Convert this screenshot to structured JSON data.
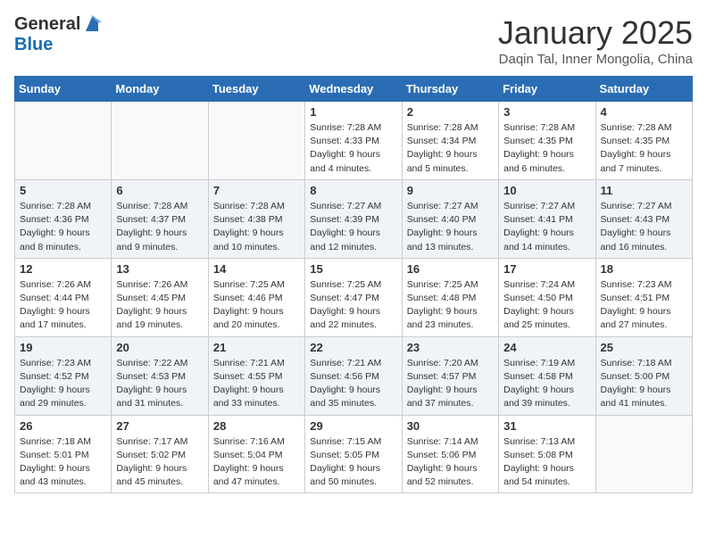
{
  "header": {
    "logo_general": "General",
    "logo_blue": "Blue",
    "title": "January 2025",
    "subtitle": "Daqin Tal, Inner Mongolia, China"
  },
  "weekdays": [
    "Sunday",
    "Monday",
    "Tuesday",
    "Wednesday",
    "Thursday",
    "Friday",
    "Saturday"
  ],
  "weeks": [
    [
      {
        "day": "",
        "info": ""
      },
      {
        "day": "",
        "info": ""
      },
      {
        "day": "",
        "info": ""
      },
      {
        "day": "1",
        "info": "Sunrise: 7:28 AM\nSunset: 4:33 PM\nDaylight: 9 hours and 4 minutes."
      },
      {
        "day": "2",
        "info": "Sunrise: 7:28 AM\nSunset: 4:34 PM\nDaylight: 9 hours and 5 minutes."
      },
      {
        "day": "3",
        "info": "Sunrise: 7:28 AM\nSunset: 4:35 PM\nDaylight: 9 hours and 6 minutes."
      },
      {
        "day": "4",
        "info": "Sunrise: 7:28 AM\nSunset: 4:35 PM\nDaylight: 9 hours and 7 minutes."
      }
    ],
    [
      {
        "day": "5",
        "info": "Sunrise: 7:28 AM\nSunset: 4:36 PM\nDaylight: 9 hours and 8 minutes."
      },
      {
        "day": "6",
        "info": "Sunrise: 7:28 AM\nSunset: 4:37 PM\nDaylight: 9 hours and 9 minutes."
      },
      {
        "day": "7",
        "info": "Sunrise: 7:28 AM\nSunset: 4:38 PM\nDaylight: 9 hours and 10 minutes."
      },
      {
        "day": "8",
        "info": "Sunrise: 7:27 AM\nSunset: 4:39 PM\nDaylight: 9 hours and 12 minutes."
      },
      {
        "day": "9",
        "info": "Sunrise: 7:27 AM\nSunset: 4:40 PM\nDaylight: 9 hours and 13 minutes."
      },
      {
        "day": "10",
        "info": "Sunrise: 7:27 AM\nSunset: 4:41 PM\nDaylight: 9 hours and 14 minutes."
      },
      {
        "day": "11",
        "info": "Sunrise: 7:27 AM\nSunset: 4:43 PM\nDaylight: 9 hours and 16 minutes."
      }
    ],
    [
      {
        "day": "12",
        "info": "Sunrise: 7:26 AM\nSunset: 4:44 PM\nDaylight: 9 hours and 17 minutes."
      },
      {
        "day": "13",
        "info": "Sunrise: 7:26 AM\nSunset: 4:45 PM\nDaylight: 9 hours and 19 minutes."
      },
      {
        "day": "14",
        "info": "Sunrise: 7:25 AM\nSunset: 4:46 PM\nDaylight: 9 hours and 20 minutes."
      },
      {
        "day": "15",
        "info": "Sunrise: 7:25 AM\nSunset: 4:47 PM\nDaylight: 9 hours and 22 minutes."
      },
      {
        "day": "16",
        "info": "Sunrise: 7:25 AM\nSunset: 4:48 PM\nDaylight: 9 hours and 23 minutes."
      },
      {
        "day": "17",
        "info": "Sunrise: 7:24 AM\nSunset: 4:50 PM\nDaylight: 9 hours and 25 minutes."
      },
      {
        "day": "18",
        "info": "Sunrise: 7:23 AM\nSunset: 4:51 PM\nDaylight: 9 hours and 27 minutes."
      }
    ],
    [
      {
        "day": "19",
        "info": "Sunrise: 7:23 AM\nSunset: 4:52 PM\nDaylight: 9 hours and 29 minutes."
      },
      {
        "day": "20",
        "info": "Sunrise: 7:22 AM\nSunset: 4:53 PM\nDaylight: 9 hours and 31 minutes."
      },
      {
        "day": "21",
        "info": "Sunrise: 7:21 AM\nSunset: 4:55 PM\nDaylight: 9 hours and 33 minutes."
      },
      {
        "day": "22",
        "info": "Sunrise: 7:21 AM\nSunset: 4:56 PM\nDaylight: 9 hours and 35 minutes."
      },
      {
        "day": "23",
        "info": "Sunrise: 7:20 AM\nSunset: 4:57 PM\nDaylight: 9 hours and 37 minutes."
      },
      {
        "day": "24",
        "info": "Sunrise: 7:19 AM\nSunset: 4:58 PM\nDaylight: 9 hours and 39 minutes."
      },
      {
        "day": "25",
        "info": "Sunrise: 7:18 AM\nSunset: 5:00 PM\nDaylight: 9 hours and 41 minutes."
      }
    ],
    [
      {
        "day": "26",
        "info": "Sunrise: 7:18 AM\nSunset: 5:01 PM\nDaylight: 9 hours and 43 minutes."
      },
      {
        "day": "27",
        "info": "Sunrise: 7:17 AM\nSunset: 5:02 PM\nDaylight: 9 hours and 45 minutes."
      },
      {
        "day": "28",
        "info": "Sunrise: 7:16 AM\nSunset: 5:04 PM\nDaylight: 9 hours and 47 minutes."
      },
      {
        "day": "29",
        "info": "Sunrise: 7:15 AM\nSunset: 5:05 PM\nDaylight: 9 hours and 50 minutes."
      },
      {
        "day": "30",
        "info": "Sunrise: 7:14 AM\nSunset: 5:06 PM\nDaylight: 9 hours and 52 minutes."
      },
      {
        "day": "31",
        "info": "Sunrise: 7:13 AM\nSunset: 5:08 PM\nDaylight: 9 hours and 54 minutes."
      },
      {
        "day": "",
        "info": ""
      }
    ]
  ]
}
